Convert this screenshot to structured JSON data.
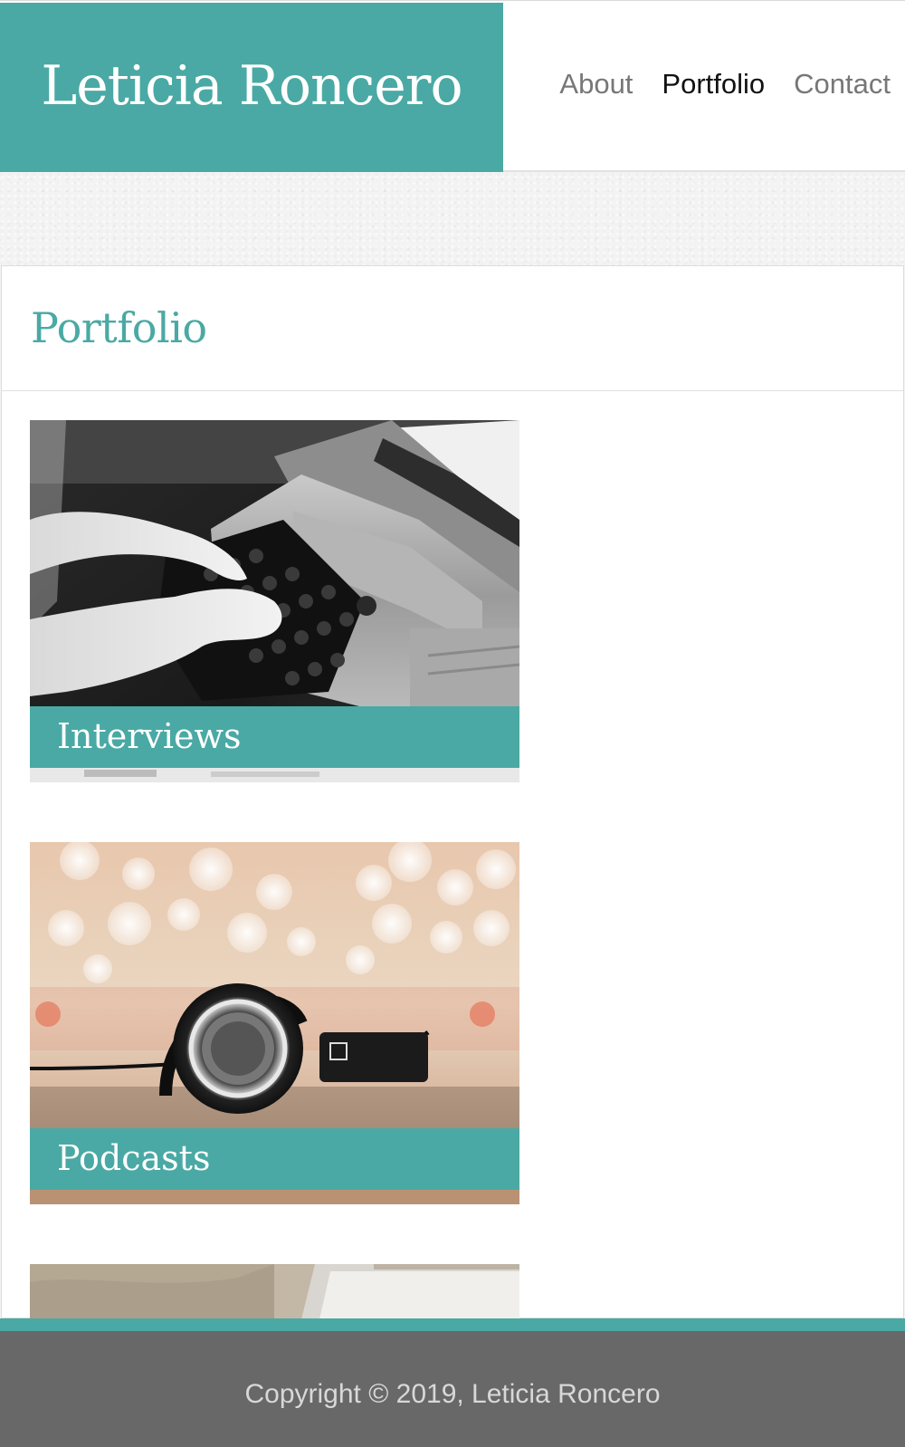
{
  "site": {
    "title": "Leticia Roncero"
  },
  "nav": {
    "items": [
      {
        "label": "About"
      },
      {
        "label": "Portfolio"
      },
      {
        "label": "Contact"
      }
    ],
    "active": "Portfolio"
  },
  "page": {
    "heading": "Portfolio"
  },
  "portfolio": {
    "items": [
      {
        "label": "Interviews",
        "image": "typewriter-photo"
      },
      {
        "label": "Podcasts",
        "image": "headphones-photo"
      },
      {
        "label": "",
        "image": "laptop-photo"
      }
    ]
  },
  "footer": {
    "copyright": "Copyright © 2019, Leticia Roncero"
  },
  "colors": {
    "accent": "#4aa9a4",
    "footer": "#686868",
    "nav_active": "#111111",
    "nav": "#777777"
  }
}
